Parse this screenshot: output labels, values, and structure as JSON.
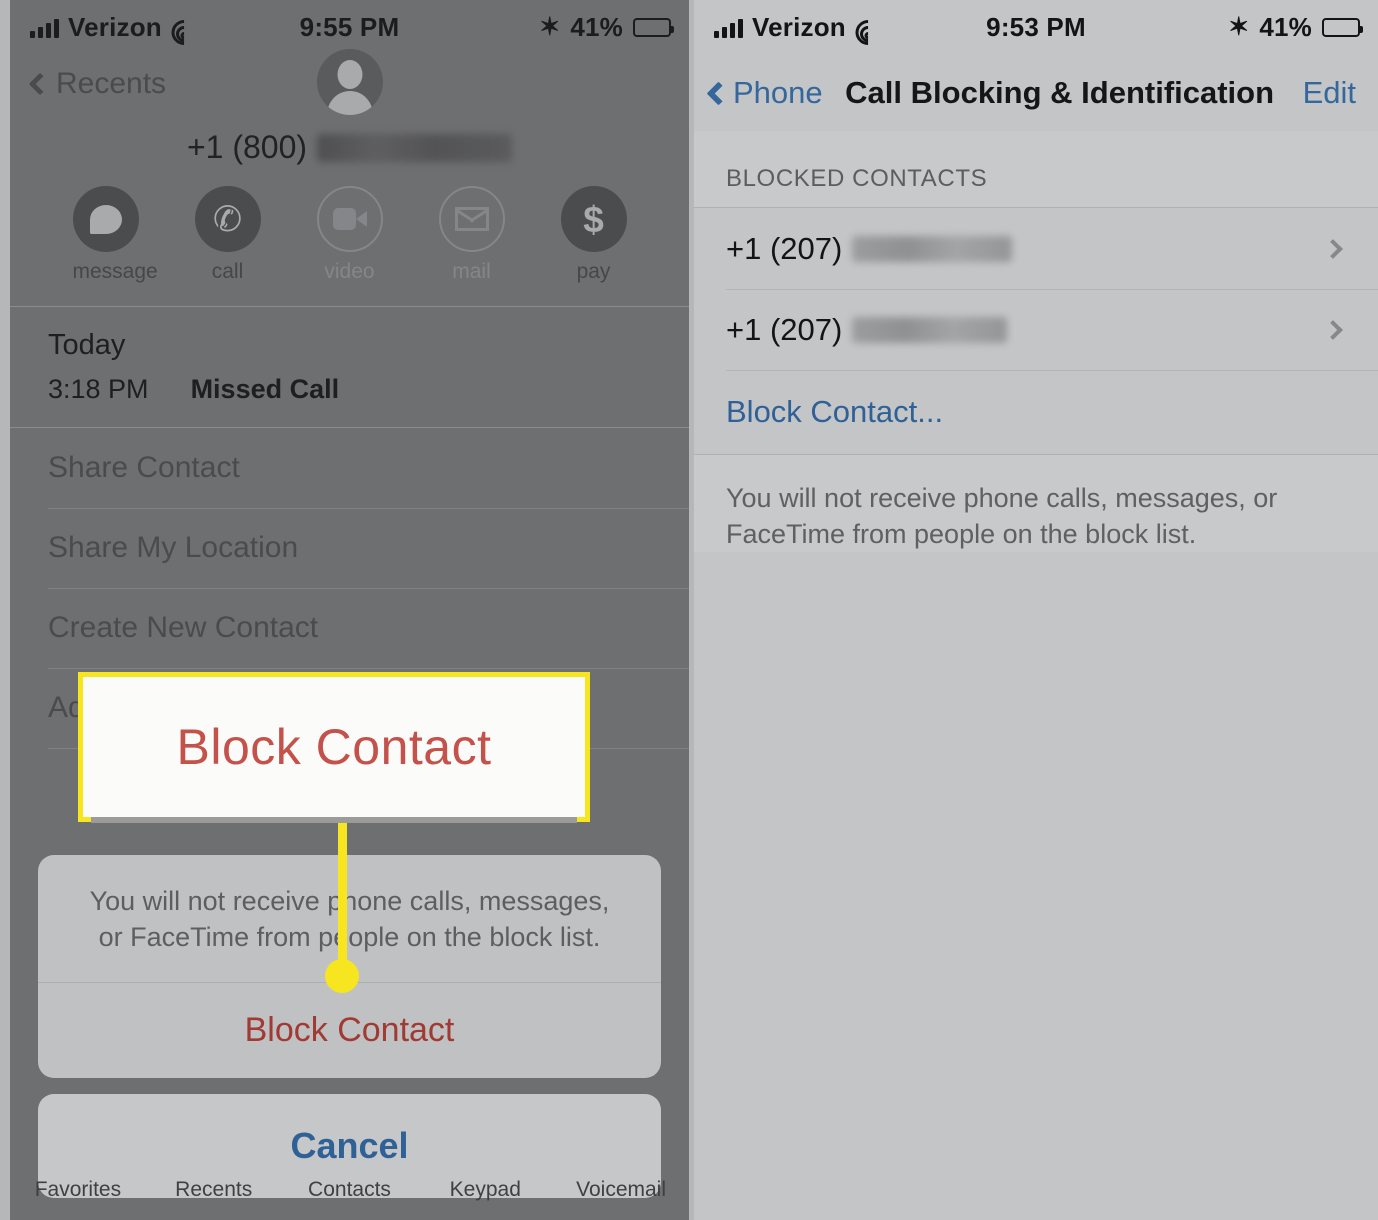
{
  "left": {
    "statusbar": {
      "carrier": "Verizon",
      "time": "9:55 PM",
      "battery_pct": "41%",
      "signal_icon": "cellular-bars-icon",
      "wifi_icon": "wifi-icon",
      "bluetooth_icon": "bluetooth-icon",
      "bluetooth_glyph": "✶",
      "battery_icon": "battery-icon"
    },
    "nav": {
      "back_label": "Recents",
      "back_icon": "chevron-left-icon",
      "avatar_icon": "contact-avatar-icon"
    },
    "contact_number_prefix": "+1 (800)",
    "contact_number_redacted": true,
    "actions": [
      {
        "label": "message",
        "icon": "message-bubble-icon",
        "enabled": true
      },
      {
        "label": "call",
        "icon": "phone-handset-icon",
        "enabled": true,
        "glyph": "✆"
      },
      {
        "label": "video",
        "icon": "video-camera-icon",
        "enabled": false
      },
      {
        "label": "mail",
        "icon": "envelope-icon",
        "enabled": false
      },
      {
        "label": "pay",
        "icon": "dollar-sign-icon",
        "enabled": true,
        "glyph": "$"
      }
    ],
    "history": {
      "day": "Today",
      "time": "3:18 PM",
      "type": "Missed Call"
    },
    "menu": [
      {
        "label": "Share Contact"
      },
      {
        "label": "Share My Location"
      },
      {
        "label": "Create New Contact"
      },
      {
        "label": "Add to Existing Contact"
      }
    ],
    "sheet": {
      "description": "You will not receive phone calls, messages, or FaceTime from people on the block list.",
      "block_label": "Block Contact",
      "cancel_label": "Cancel"
    },
    "tabs": [
      {
        "label": "Favorites"
      },
      {
        "label": "Recents"
      },
      {
        "label": "Contacts"
      },
      {
        "label": "Keypad"
      },
      {
        "label": "Voicemail"
      }
    ]
  },
  "right": {
    "statusbar": {
      "carrier": "Verizon",
      "time": "9:53 PM",
      "battery_pct": "41%",
      "bluetooth_glyph": "✶"
    },
    "nav": {
      "back_label": "Phone",
      "back_icon": "chevron-left-icon",
      "title": "Call Blocking & Identification",
      "edit_label": "Edit"
    },
    "section_header": "BLOCKED CONTACTS",
    "blocked_contacts": [
      {
        "prefix": "+1 (207)",
        "redacted": true,
        "chevron": "chevron-right-icon"
      },
      {
        "prefix": "+1 (207)",
        "redacted": true,
        "chevron": "chevron-right-icon"
      }
    ],
    "block_contact_link": "Block Contact...",
    "footer_note": "You will not receive phone calls, messages, or FaceTime from people on the block list."
  },
  "callout": {
    "text": "Block Contact",
    "border_color": "#f7e520",
    "text_color": "#c4524b",
    "background_color": "#fbfbfa"
  },
  "colors": {
    "dim_panel": "#6e6f71",
    "light_panel": "#c4c5c7",
    "ios_blue": "#2f6096",
    "destructive_red": "#a03a32",
    "highlight_yellow": "#f7e520"
  }
}
